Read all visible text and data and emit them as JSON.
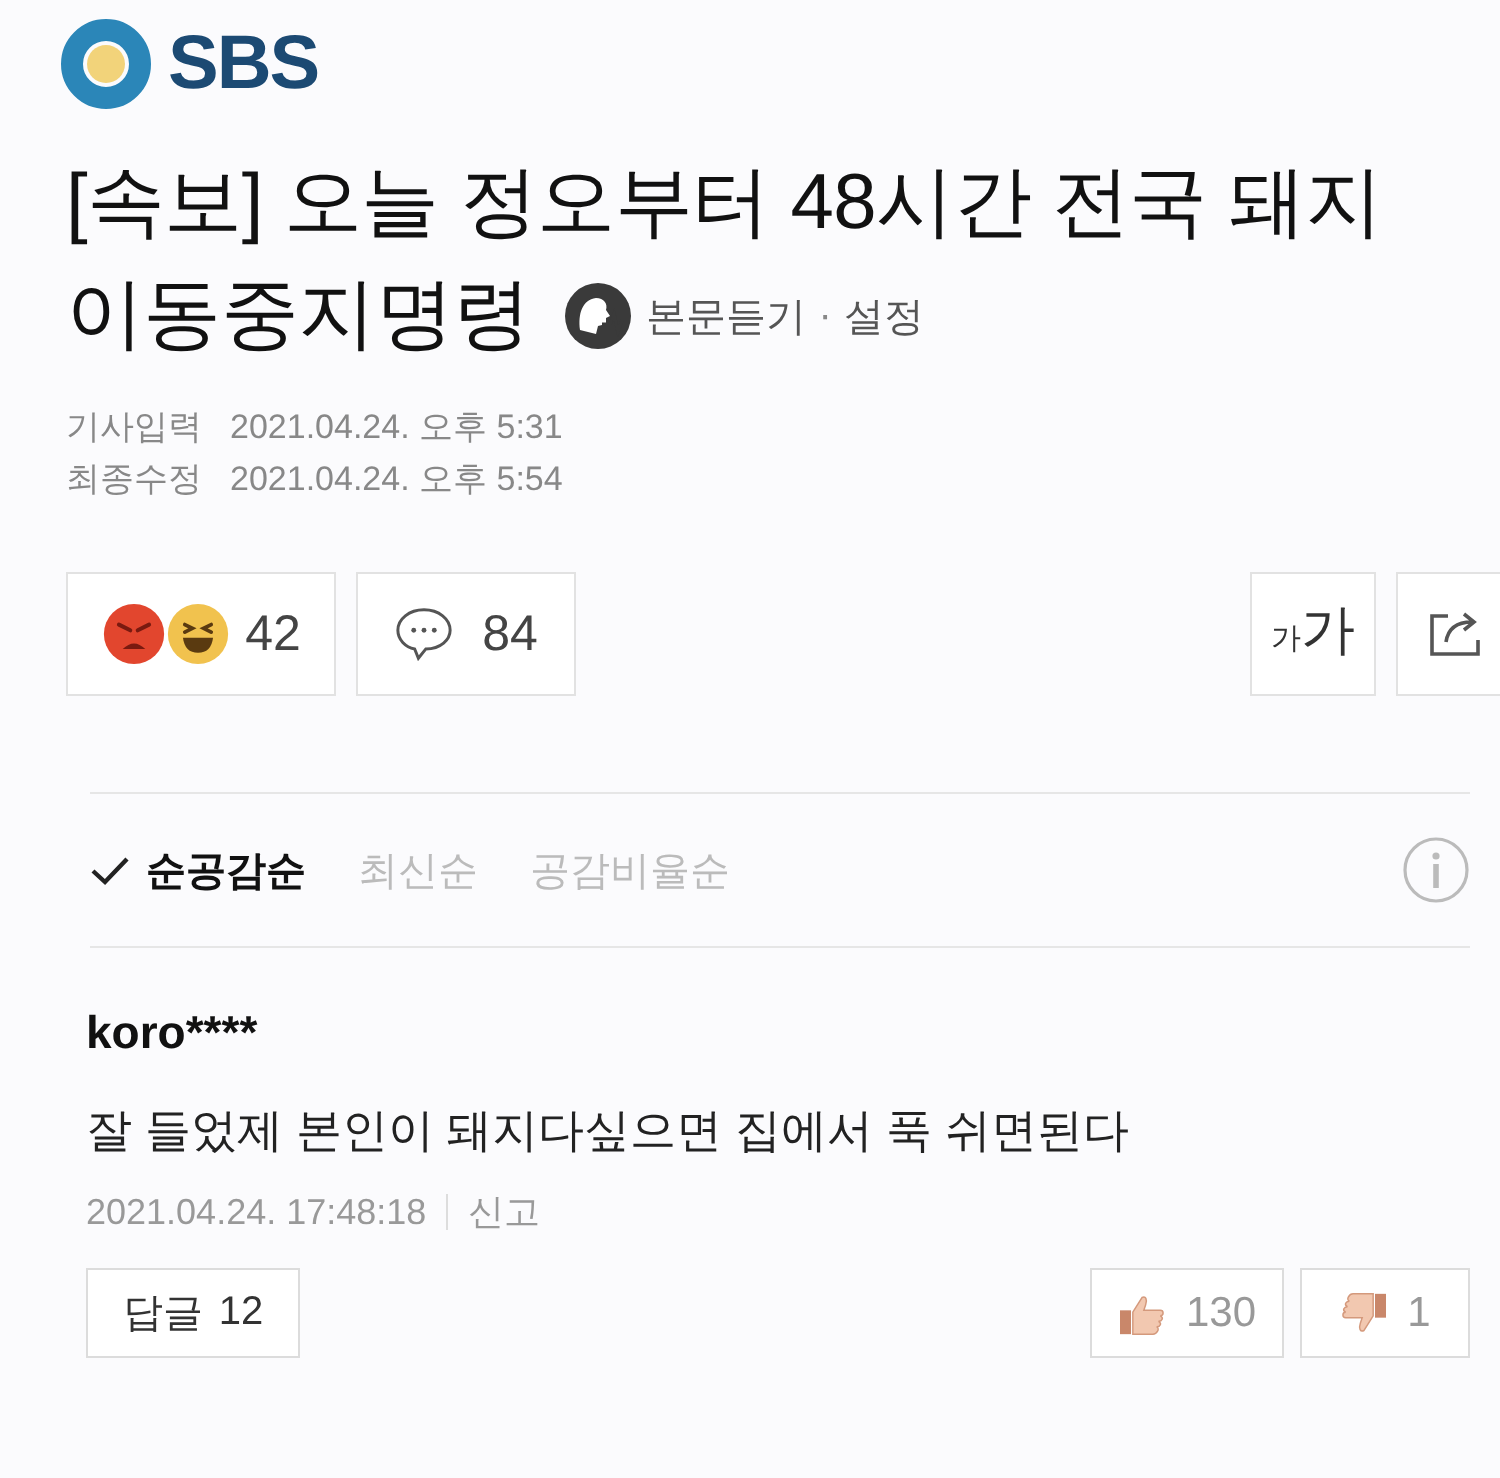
{
  "logo": {
    "text": "SBS"
  },
  "article": {
    "title_lines": [
      "[속보] 오늘 정오부터 48시간 전국 돼지",
      "이동중지명령"
    ],
    "listen": {
      "label": "본문듣기",
      "separator": "·",
      "settings": "설정"
    },
    "meta": [
      {
        "label": "기사입력",
        "value": "2021.04.24. 오후 5:31"
      },
      {
        "label": "최종수정",
        "value": "2021.04.24. 오후 5:54"
      }
    ]
  },
  "actions": {
    "reactions": {
      "count": "42"
    },
    "comments": {
      "count": "84"
    },
    "font_size": {
      "small": "가",
      "large": "가"
    }
  },
  "sort_options": [
    {
      "label": "순공감순",
      "selected": true
    },
    {
      "label": "최신순",
      "selected": false
    },
    {
      "label": "공감비율순",
      "selected": false
    }
  ],
  "comments": [
    {
      "author": "koro****",
      "text": "잘 들었제 본인이 돼지다싶으면 집에서 푹 쉬면된다",
      "time": "2021.04.24. 17:48:18",
      "report": "신고",
      "reply": {
        "label": "답글",
        "count": "12"
      },
      "likes": "130",
      "dislikes": "1"
    }
  ]
}
